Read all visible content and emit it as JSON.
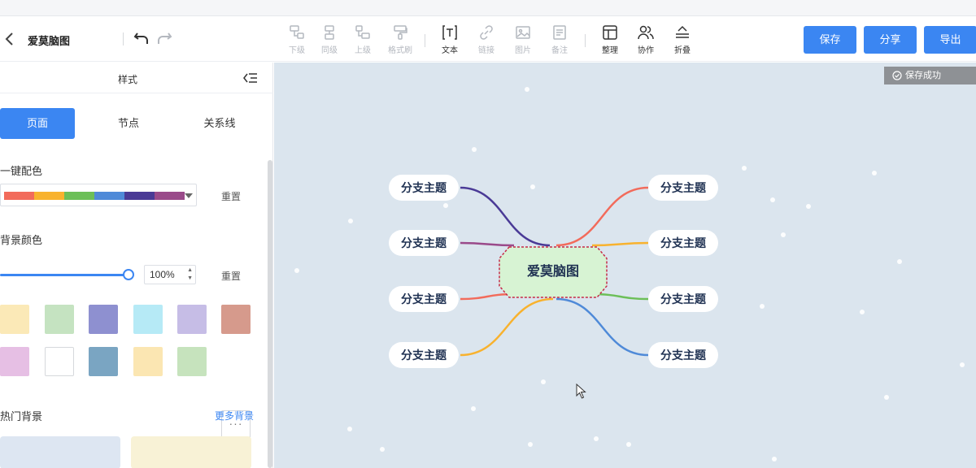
{
  "header": {
    "title": "爱莫脑图",
    "tools": [
      {
        "label": "下级",
        "icon": "child-node-icon"
      },
      {
        "label": "同级",
        "icon": "sibling-node-icon"
      },
      {
        "label": "上级",
        "icon": "parent-node-icon"
      },
      {
        "label": "格式刷",
        "icon": "format-brush-icon"
      },
      {
        "label": "文本",
        "icon": "text-icon"
      },
      {
        "label": "链接",
        "icon": "link-icon"
      },
      {
        "label": "图片",
        "icon": "image-icon"
      },
      {
        "label": "备注",
        "icon": "note-icon"
      },
      {
        "label": "整理",
        "icon": "layout-icon"
      },
      {
        "label": "协作",
        "icon": "collaborate-icon"
      },
      {
        "label": "折叠",
        "icon": "collapse-icon"
      }
    ],
    "buttons": {
      "save": "保存",
      "share": "分享",
      "export": "导出"
    }
  },
  "panel": {
    "title": "样式",
    "tabs": [
      "页面",
      "节点",
      "关系线"
    ],
    "active_tab": "页面",
    "color_scheme_label": "一键配色",
    "reset_label": "重置",
    "bg_color_label": "背景颜色",
    "opacity_value": "100",
    "opacity_unit": "%",
    "opacity_fraction": 1.0,
    "hot_bg_label": "热门背景",
    "more_bg_label": "更多背景",
    "palette_colors": [
      "#f26b5b",
      "#f8b22e",
      "#6cbf58",
      "#4f8ad8",
      "#4a3a96",
      "#9a4a8a"
    ],
    "swatches": [
      "#fbe9b7",
      "#c5e3c1",
      "#8e90d0",
      "#b6eaf6",
      "#c6bde6",
      "#d69a8c",
      "#e6bfe4",
      "#ffffff",
      "#7aa5c2",
      "#fbe6b2",
      "#c6e3bd"
    ],
    "bg_thumbs": [
      "#dde6f2",
      "#f8f2d6"
    ]
  },
  "canvas": {
    "toast": "保存成功",
    "background": "#dbe5ee",
    "root": {
      "text": "爱莫脑图",
      "fill": "#d7f3d3",
      "border": "#c62a47"
    },
    "branches_left": [
      {
        "text": "分支主题",
        "color": "#4a3a96"
      },
      {
        "text": "分支主题",
        "color": "#9a4a8a"
      },
      {
        "text": "分支主题",
        "color": "#f26b5b"
      },
      {
        "text": "分支主题",
        "color": "#f8b22e"
      }
    ],
    "branches_right": [
      {
        "text": "分支主题",
        "color": "#f26b5b"
      },
      {
        "text": "分支主题",
        "color": "#f8b22e"
      },
      {
        "text": "分支主题",
        "color": "#6cbf58"
      },
      {
        "text": "分支主题",
        "color": "#4f8ad8"
      }
    ]
  }
}
